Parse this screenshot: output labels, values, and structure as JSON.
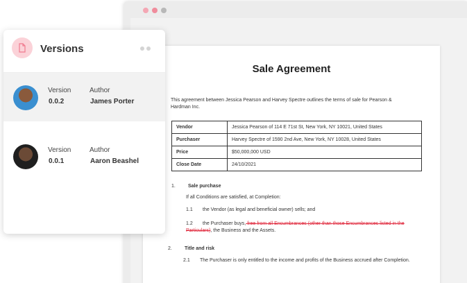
{
  "panel": {
    "title": "Versions",
    "icon": "document-icon",
    "versions": [
      {
        "version_label": "Version",
        "version": "0.0.2",
        "author_label": "Author",
        "author": "James Porter",
        "selected": true
      },
      {
        "version_label": "Version",
        "version": "0.0.1",
        "author_label": "Author",
        "author": "Aaron Beashel",
        "selected": false
      }
    ]
  },
  "document": {
    "title": "Sale Agreement",
    "intro": "This agreement between Jessica Pearson and Harvey Spectre outlines the terms of sale for Pearson & Hardman Inc.",
    "table": [
      {
        "key": "Vendor",
        "value": "Jessica Pearson of 114 E 71st St, New York, NY 10021, United States"
      },
      {
        "key": "Purchaser",
        "value": "Harvey Spectre of 1590 2nd Ave, New York, NY 10028, United States"
      },
      {
        "key": "Price",
        "value": "$50,000,000 USD"
      },
      {
        "key": "Close Date",
        "value": "24/10/2021"
      }
    ],
    "sections": {
      "s1_num": "1.",
      "s1_title": "Sale purchase",
      "s1_intro": "If all Conditions are satisfied, at Completion:",
      "s11_num": "1.1",
      "s11_text": "the Vendor (as legal and beneficial owner) sells; and",
      "s12_num": "1.2",
      "s12_text_a": "the Purchaser buys,",
      "s12_strike": " free from all Encumbrances (other than those Encumbrances listed in the Particulars)",
      "s12_text_b": ", the Business and the Assets.",
      "s2_num": "2.",
      "s2_title": "Title and risk",
      "s21_num": "2.1",
      "s21_text": "The Purchaser is only entitled to the income and profits of the Business accrued after Completion."
    }
  },
  "colors": {
    "accent_pink": "#fbd2d8",
    "strike_red": "#e0283c"
  }
}
